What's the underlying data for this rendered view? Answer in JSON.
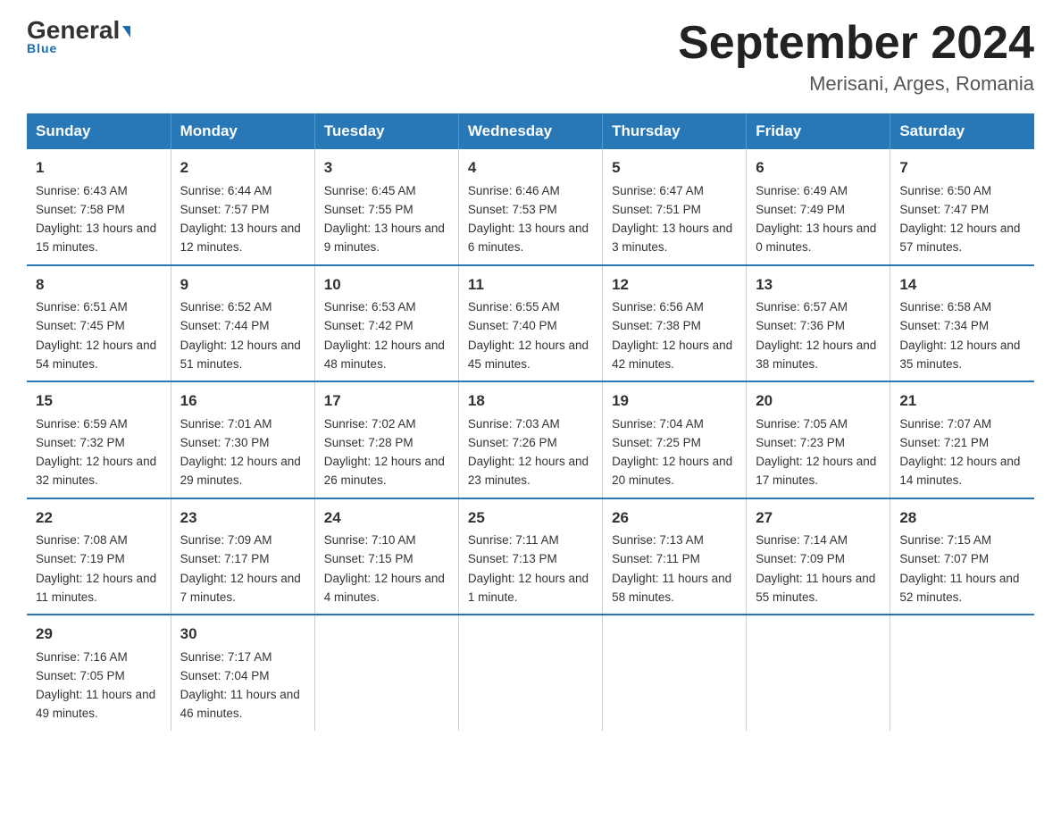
{
  "header": {
    "logo_general": "General",
    "logo_blue": "Blue",
    "title": "September 2024",
    "subtitle": "Merisani, Arges, Romania"
  },
  "days_of_week": [
    "Sunday",
    "Monday",
    "Tuesday",
    "Wednesday",
    "Thursday",
    "Friday",
    "Saturday"
  ],
  "weeks": [
    [
      {
        "day": "1",
        "sunrise": "6:43 AM",
        "sunset": "7:58 PM",
        "daylight": "13 hours and 15 minutes."
      },
      {
        "day": "2",
        "sunrise": "6:44 AM",
        "sunset": "7:57 PM",
        "daylight": "13 hours and 12 minutes."
      },
      {
        "day": "3",
        "sunrise": "6:45 AM",
        "sunset": "7:55 PM",
        "daylight": "13 hours and 9 minutes."
      },
      {
        "day": "4",
        "sunrise": "6:46 AM",
        "sunset": "7:53 PM",
        "daylight": "13 hours and 6 minutes."
      },
      {
        "day": "5",
        "sunrise": "6:47 AM",
        "sunset": "7:51 PM",
        "daylight": "13 hours and 3 minutes."
      },
      {
        "day": "6",
        "sunrise": "6:49 AM",
        "sunset": "7:49 PM",
        "daylight": "13 hours and 0 minutes."
      },
      {
        "day": "7",
        "sunrise": "6:50 AM",
        "sunset": "7:47 PM",
        "daylight": "12 hours and 57 minutes."
      }
    ],
    [
      {
        "day": "8",
        "sunrise": "6:51 AM",
        "sunset": "7:45 PM",
        "daylight": "12 hours and 54 minutes."
      },
      {
        "day": "9",
        "sunrise": "6:52 AM",
        "sunset": "7:44 PM",
        "daylight": "12 hours and 51 minutes."
      },
      {
        "day": "10",
        "sunrise": "6:53 AM",
        "sunset": "7:42 PM",
        "daylight": "12 hours and 48 minutes."
      },
      {
        "day": "11",
        "sunrise": "6:55 AM",
        "sunset": "7:40 PM",
        "daylight": "12 hours and 45 minutes."
      },
      {
        "day": "12",
        "sunrise": "6:56 AM",
        "sunset": "7:38 PM",
        "daylight": "12 hours and 42 minutes."
      },
      {
        "day": "13",
        "sunrise": "6:57 AM",
        "sunset": "7:36 PM",
        "daylight": "12 hours and 38 minutes."
      },
      {
        "day": "14",
        "sunrise": "6:58 AM",
        "sunset": "7:34 PM",
        "daylight": "12 hours and 35 minutes."
      }
    ],
    [
      {
        "day": "15",
        "sunrise": "6:59 AM",
        "sunset": "7:32 PM",
        "daylight": "12 hours and 32 minutes."
      },
      {
        "day": "16",
        "sunrise": "7:01 AM",
        "sunset": "7:30 PM",
        "daylight": "12 hours and 29 minutes."
      },
      {
        "day": "17",
        "sunrise": "7:02 AM",
        "sunset": "7:28 PM",
        "daylight": "12 hours and 26 minutes."
      },
      {
        "day": "18",
        "sunrise": "7:03 AM",
        "sunset": "7:26 PM",
        "daylight": "12 hours and 23 minutes."
      },
      {
        "day": "19",
        "sunrise": "7:04 AM",
        "sunset": "7:25 PM",
        "daylight": "12 hours and 20 minutes."
      },
      {
        "day": "20",
        "sunrise": "7:05 AM",
        "sunset": "7:23 PM",
        "daylight": "12 hours and 17 minutes."
      },
      {
        "day": "21",
        "sunrise": "7:07 AM",
        "sunset": "7:21 PM",
        "daylight": "12 hours and 14 minutes."
      }
    ],
    [
      {
        "day": "22",
        "sunrise": "7:08 AM",
        "sunset": "7:19 PM",
        "daylight": "12 hours and 11 minutes."
      },
      {
        "day": "23",
        "sunrise": "7:09 AM",
        "sunset": "7:17 PM",
        "daylight": "12 hours and 7 minutes."
      },
      {
        "day": "24",
        "sunrise": "7:10 AM",
        "sunset": "7:15 PM",
        "daylight": "12 hours and 4 minutes."
      },
      {
        "day": "25",
        "sunrise": "7:11 AM",
        "sunset": "7:13 PM",
        "daylight": "12 hours and 1 minute."
      },
      {
        "day": "26",
        "sunrise": "7:13 AM",
        "sunset": "7:11 PM",
        "daylight": "11 hours and 58 minutes."
      },
      {
        "day": "27",
        "sunrise": "7:14 AM",
        "sunset": "7:09 PM",
        "daylight": "11 hours and 55 minutes."
      },
      {
        "day": "28",
        "sunrise": "7:15 AM",
        "sunset": "7:07 PM",
        "daylight": "11 hours and 52 minutes."
      }
    ],
    [
      {
        "day": "29",
        "sunrise": "7:16 AM",
        "sunset": "7:05 PM",
        "daylight": "11 hours and 49 minutes."
      },
      {
        "day": "30",
        "sunrise": "7:17 AM",
        "sunset": "7:04 PM",
        "daylight": "11 hours and 46 minutes."
      },
      {
        "day": "",
        "sunrise": "",
        "sunset": "",
        "daylight": ""
      },
      {
        "day": "",
        "sunrise": "",
        "sunset": "",
        "daylight": ""
      },
      {
        "day": "",
        "sunrise": "",
        "sunset": "",
        "daylight": ""
      },
      {
        "day": "",
        "sunrise": "",
        "sunset": "",
        "daylight": ""
      },
      {
        "day": "",
        "sunrise": "",
        "sunset": "",
        "daylight": ""
      }
    ]
  ],
  "labels": {
    "sunrise": "Sunrise:",
    "sunset": "Sunset:",
    "daylight": "Daylight:"
  }
}
